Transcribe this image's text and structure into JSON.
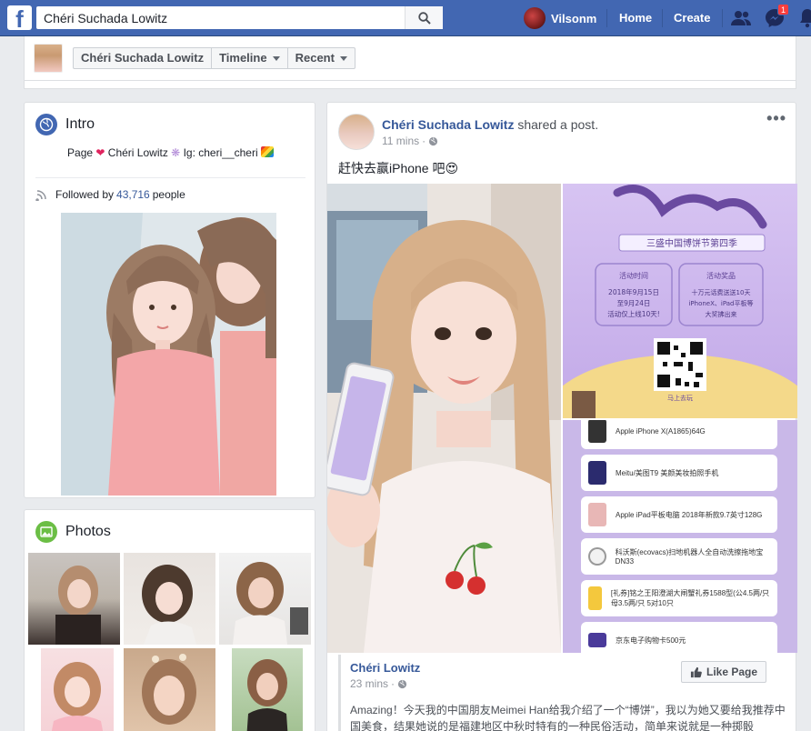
{
  "topbar": {
    "logo": "f",
    "search_value": "Chéri Suchada Lowitz",
    "user_name": "Vilsonm",
    "home": "Home",
    "create": "Create",
    "messages_badge": "1",
    "icons": [
      "search-icon",
      "friends-icon",
      "messenger-icon",
      "notifications-icon"
    ]
  },
  "subnav": {
    "crumbs": [
      "Chéri Suchada Lowitz",
      "Timeline",
      "Recent"
    ]
  },
  "intro": {
    "title": "Intro",
    "bio_page": "Page",
    "bio_name": "Chéri Lowitz",
    "bio_ig": "Ig: cheri__cheri",
    "followed_prefix": "Followed by",
    "followed_count": "43,716",
    "followed_suffix": "people"
  },
  "photos": {
    "title": "Photos"
  },
  "post": {
    "author": "Chéri Suchada Lowitz",
    "action": "shared a post.",
    "time": "11 mins",
    "text": "赶快去赢iPhone 吧",
    "emoji": "😍",
    "shared": {
      "name": "Chéri Lowitz",
      "time": "23 mins",
      "like_page": "Like Page",
      "text": "Amazing！今天我的中国朋友Meimei Han给我介绍了一个“博饼”，我以为她又要给我推荐中国美食，结果她说的是福建地区中秋时特有的一种民俗活动，简单来说就是一种掷骰"
    },
    "poster": {
      "title": "三盛中国博饼节第四季",
      "box1_title": "活动时间",
      "box1_lines": [
        "2018年9月15日",
        "至9月24日",
        "活动仅上线10天!"
      ],
      "box2_title": "活动奖品",
      "box2_lines": [
        "十万元话费送送10天",
        "iPhoneX、iPad平板等",
        "大奖拂出来"
      ],
      "qr_caption": "马上去玩"
    },
    "prize_list": [
      "Apple iPhone X(A1865)64G",
      "Meitu/美图T9 美颜美妆拍照手机",
      "Apple iPad平板电脑 2018年新款9.7英寸128G",
      "科沃斯(ecovacs)扫地机器人全自动洗擦拖地宝DN33",
      "[礼券]铭之王阳澄湖大闸蟹礼券1588型(公4.5两/只 母3.5两/只 5对10只",
      "京东电子购物卡500元"
    ]
  },
  "colors": {
    "brand": "#4267b2",
    "link": "#365899",
    "badge": "#fa3e3e",
    "page_bg": "#e9ebee"
  }
}
